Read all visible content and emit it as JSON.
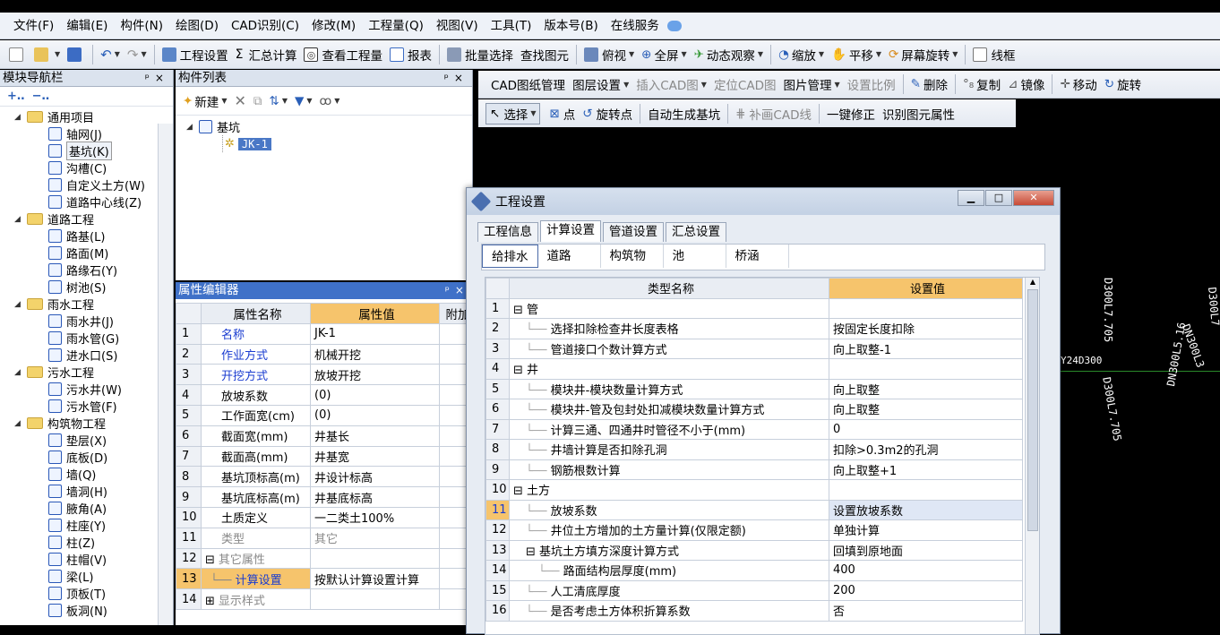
{
  "menu": [
    "文件(F)",
    "编辑(E)",
    "构件(N)",
    "绘图(D)",
    "CAD识别(C)",
    "修改(M)",
    "工程量(Q)",
    "视图(V)",
    "工具(T)",
    "版本号(B)",
    "在线服务"
  ],
  "toolbar1": {
    "items": [
      "工程设置",
      "汇总计算",
      "查看工程量",
      "报表",
      "批量选择",
      "查找图元",
      "俯视",
      "全屏",
      "动态观察",
      "缩放",
      "平移",
      "屏幕旋转",
      "线框"
    ]
  },
  "left_panel": {
    "title": "模块导航栏",
    "tree": [
      {
        "label": "通用项目",
        "type": "folder"
      },
      {
        "label": "轴网(J)",
        "type": "item"
      },
      {
        "label": "基坑(K)",
        "type": "item",
        "selected": true
      },
      {
        "label": "沟槽(C)",
        "type": "item"
      },
      {
        "label": "自定义土方(W)",
        "type": "item"
      },
      {
        "label": "道路中心线(Z)",
        "type": "item"
      },
      {
        "label": "道路工程",
        "type": "folder"
      },
      {
        "label": "路基(L)",
        "type": "item"
      },
      {
        "label": "路面(M)",
        "type": "item"
      },
      {
        "label": "路缘石(Y)",
        "type": "item"
      },
      {
        "label": "树池(S)",
        "type": "item"
      },
      {
        "label": "雨水工程",
        "type": "folder"
      },
      {
        "label": "雨水井(J)",
        "type": "item"
      },
      {
        "label": "雨水管(G)",
        "type": "item"
      },
      {
        "label": "进水口(S)",
        "type": "item"
      },
      {
        "label": "污水工程",
        "type": "folder"
      },
      {
        "label": "污水井(W)",
        "type": "item"
      },
      {
        "label": "污水管(F)",
        "type": "item"
      },
      {
        "label": "构筑物工程",
        "type": "folder"
      },
      {
        "label": "垫层(X)",
        "type": "item"
      },
      {
        "label": "底板(D)",
        "type": "item"
      },
      {
        "label": "墙(Q)",
        "type": "item"
      },
      {
        "label": "墙洞(H)",
        "type": "item"
      },
      {
        "label": "腋角(A)",
        "type": "item"
      },
      {
        "label": "柱座(Y)",
        "type": "item"
      },
      {
        "label": "柱(Z)",
        "type": "item"
      },
      {
        "label": "柱帽(V)",
        "type": "item"
      },
      {
        "label": "梁(L)",
        "type": "item"
      },
      {
        "label": "顶板(T)",
        "type": "item"
      },
      {
        "label": "板洞(N)",
        "type": "item"
      }
    ]
  },
  "component_list": {
    "title": "构件列表",
    "new_label": "新建",
    "root": "基坑",
    "child": "JK-1"
  },
  "property_editor": {
    "title": "属性编辑器",
    "headers": [
      "属性名称",
      "属性值",
      "附加"
    ],
    "rows": [
      {
        "n": "1",
        "name": "名称",
        "value": "JK-1",
        "style": "blue"
      },
      {
        "n": "2",
        "name": "作业方式",
        "value": "机械开挖",
        "style": "blue"
      },
      {
        "n": "3",
        "name": "开挖方式",
        "value": "放坡开挖",
        "style": "blue"
      },
      {
        "n": "4",
        "name": "放坡系数",
        "value": "(0)",
        "style": ""
      },
      {
        "n": "5",
        "name": "工作面宽(cm)",
        "value": "(0)",
        "style": ""
      },
      {
        "n": "6",
        "name": "截面宽(mm)",
        "value": "井基长",
        "style": ""
      },
      {
        "n": "7",
        "name": "截面高(mm)",
        "value": "井基宽",
        "style": ""
      },
      {
        "n": "8",
        "name": "基坑顶标高(m)",
        "value": "井设计标高",
        "style": ""
      },
      {
        "n": "9",
        "name": "基坑底标高(m)",
        "value": "井基底标高",
        "style": ""
      },
      {
        "n": "10",
        "name": "土质定义",
        "value": "一二类土100%",
        "style": ""
      },
      {
        "n": "11",
        "name": "类型",
        "value": "其它",
        "style": "gray"
      },
      {
        "n": "12",
        "name": "其它属性",
        "value": "",
        "style": "gray",
        "group": "-"
      },
      {
        "n": "13",
        "name": "计算设置",
        "value": "按默认计算设置计算",
        "style": "blue",
        "selected": true
      },
      {
        "n": "14",
        "name": "显示样式",
        "value": "",
        "style": "gray",
        "group": "+"
      }
    ]
  },
  "cad_toolbar1": [
    "CAD图纸管理",
    "图层设置",
    "插入CAD图",
    "定位CAD图",
    "图片管理",
    "设置比例",
    "删除",
    "复制",
    "镜像",
    "移动",
    "旋转"
  ],
  "cad_toolbar2": [
    "选择",
    "点",
    "旋转点",
    "自动生成基坑",
    "补画CAD线",
    "一键修正",
    "识别图元属性"
  ],
  "cad_texts": [
    "D300L7.705",
    "D300L7.705",
    "DN300L5.16",
    "DN300L3",
    "D300L7",
    "Y24D300"
  ],
  "dialog": {
    "title": "工程设置",
    "tabs": [
      "工程信息",
      "计算设置",
      "管道设置",
      "汇总设置"
    ],
    "active_tab": 1,
    "subtabs": [
      "给排水",
      "道路",
      "构筑物",
      "池",
      "桥涵"
    ],
    "active_subtab": 0,
    "headers": [
      "类型名称",
      "设置值"
    ],
    "rows": [
      {
        "n": "1",
        "name": "管",
        "value": "",
        "level": 0,
        "group": true
      },
      {
        "n": "2",
        "name": "选择扣除检查井长度表格",
        "value": "按固定长度扣除",
        "level": 1
      },
      {
        "n": "3",
        "name": "管道接口个数计算方式",
        "value": "向上取整-1",
        "level": 1
      },
      {
        "n": "4",
        "name": "井",
        "value": "",
        "level": 0,
        "group": true
      },
      {
        "n": "5",
        "name": "模块井-模块数量计算方式",
        "value": "向上取整",
        "level": 1
      },
      {
        "n": "6",
        "name": "模块井-管及包封处扣减模块数量计算方式",
        "value": "向上取整",
        "level": 1
      },
      {
        "n": "7",
        "name": "计算三通、四通井时管径不小于(mm)",
        "value": "0",
        "level": 1
      },
      {
        "n": "8",
        "name": "井墙计算是否扣除孔洞",
        "value": "扣除>0.3m2的孔洞",
        "level": 1
      },
      {
        "n": "9",
        "name": "钢筋根数计算",
        "value": "向上取整+1",
        "level": 1
      },
      {
        "n": "10",
        "name": "土方",
        "value": "",
        "level": 0,
        "group": true
      },
      {
        "n": "11",
        "name": "放坡系数",
        "value": "设置放坡系数",
        "level": 1,
        "selected": true
      },
      {
        "n": "12",
        "name": "井位土方增加的土方量计算(仅限定额)",
        "value": "单独计算",
        "level": 1
      },
      {
        "n": "13",
        "name": "基坑土方填方深度计算方式",
        "value": "回填到原地面",
        "level": 1,
        "group": true
      },
      {
        "n": "14",
        "name": "路面结构层厚度(mm)",
        "value": "400",
        "level": 2
      },
      {
        "n": "15",
        "name": "人工清底厚度",
        "value": "200",
        "level": 1
      },
      {
        "n": "16",
        "name": "是否考虑土方体积折算系数",
        "value": "否",
        "level": 1
      }
    ]
  }
}
